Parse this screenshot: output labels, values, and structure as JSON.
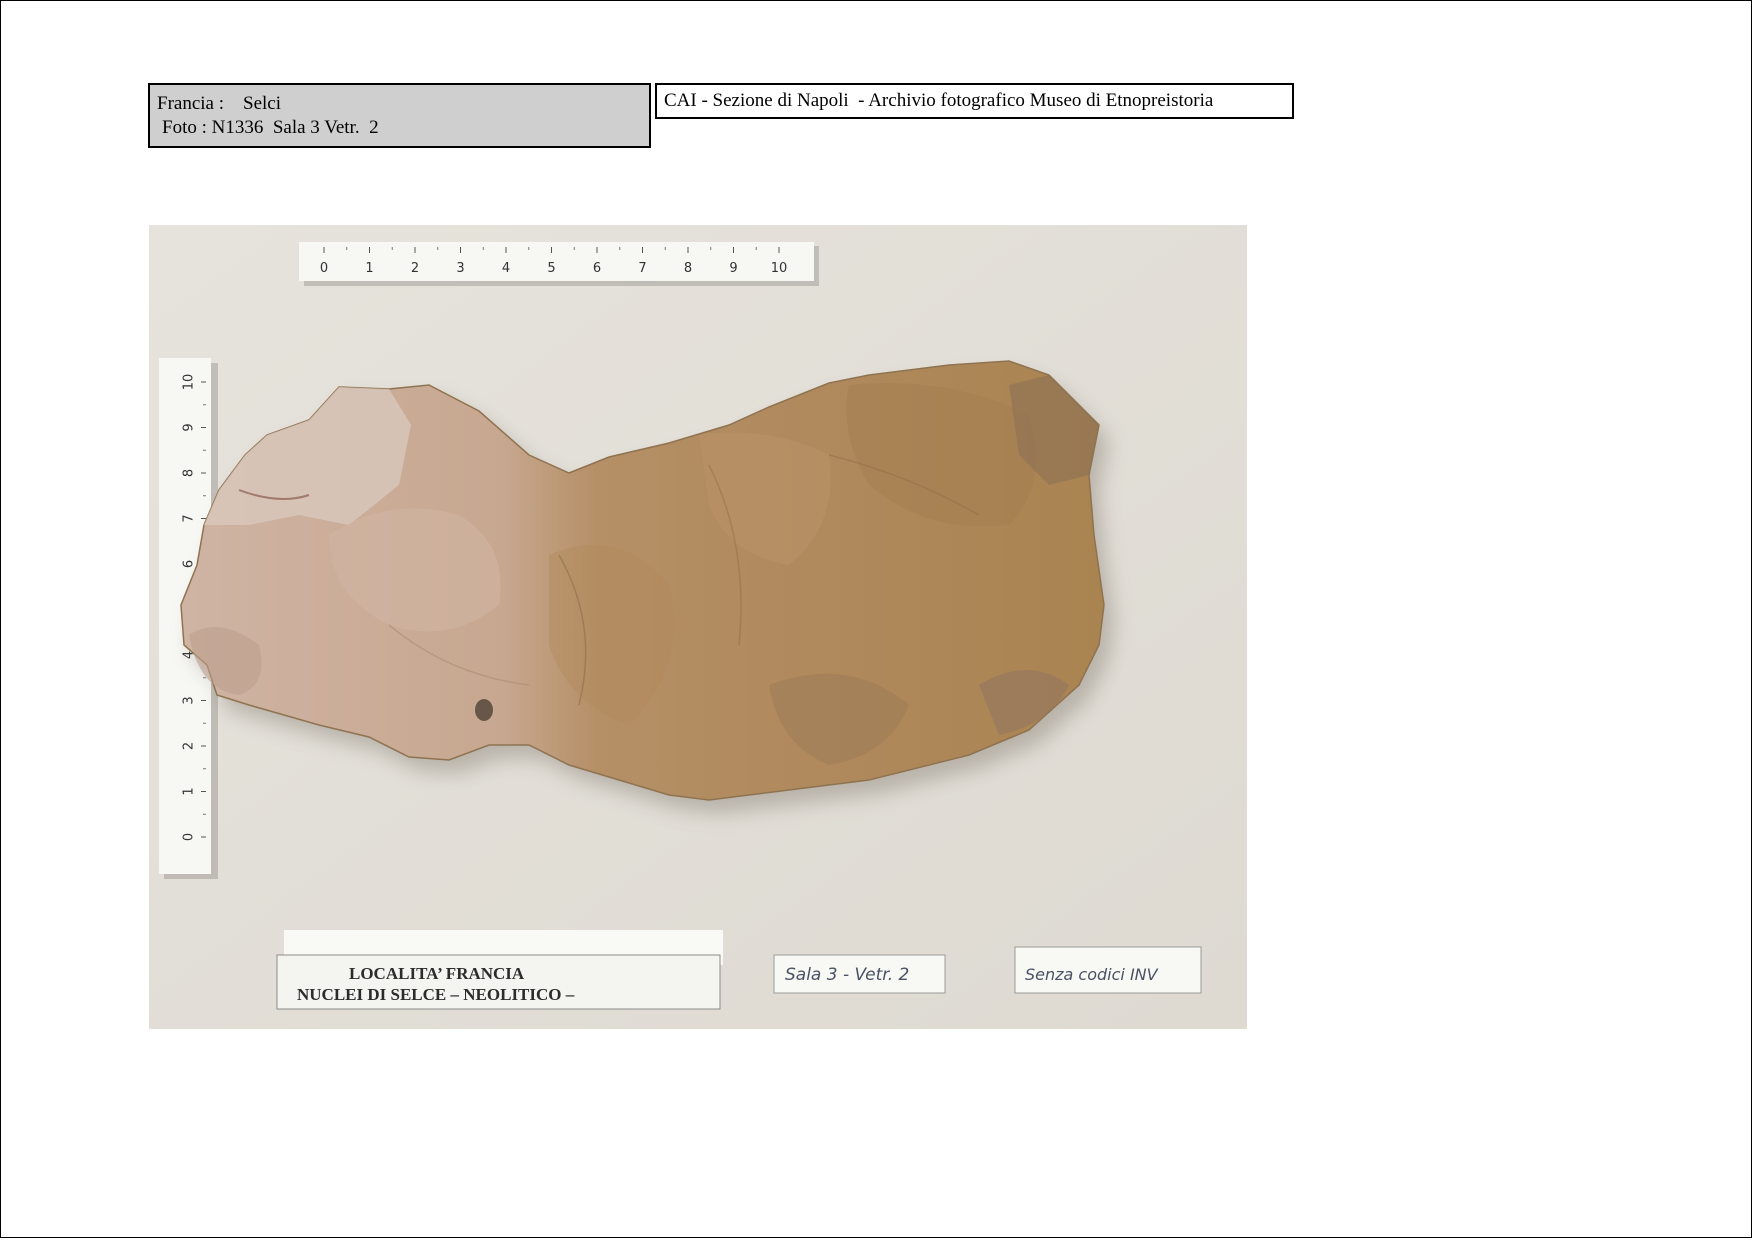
{
  "header": {
    "line1": "Francia :    Selci",
    "line2": "Foto : N1336  Sala 3 Vetr.  2",
    "archive": "CAI - Sezione di Napoli  - Archivio fotografico Museo di Etnopreistoria"
  },
  "photo": {
    "ruler_labels": [
      "0",
      "1",
      "2",
      "3",
      "4",
      "5",
      "6",
      "7",
      "8",
      "9",
      "10"
    ],
    "label_line1": "LOCALITA’ FRANCIA",
    "label_line2": "NUCLEI DI SELCE – NEOLITICO –",
    "label_sala": "Sala 3 - Vetr. 2",
    "label_inv": "Senza codici INV"
  },
  "colors": {
    "background": "#e4e1da",
    "flint_light": "#c9a88e",
    "flint_dark": "#a88456"
  }
}
